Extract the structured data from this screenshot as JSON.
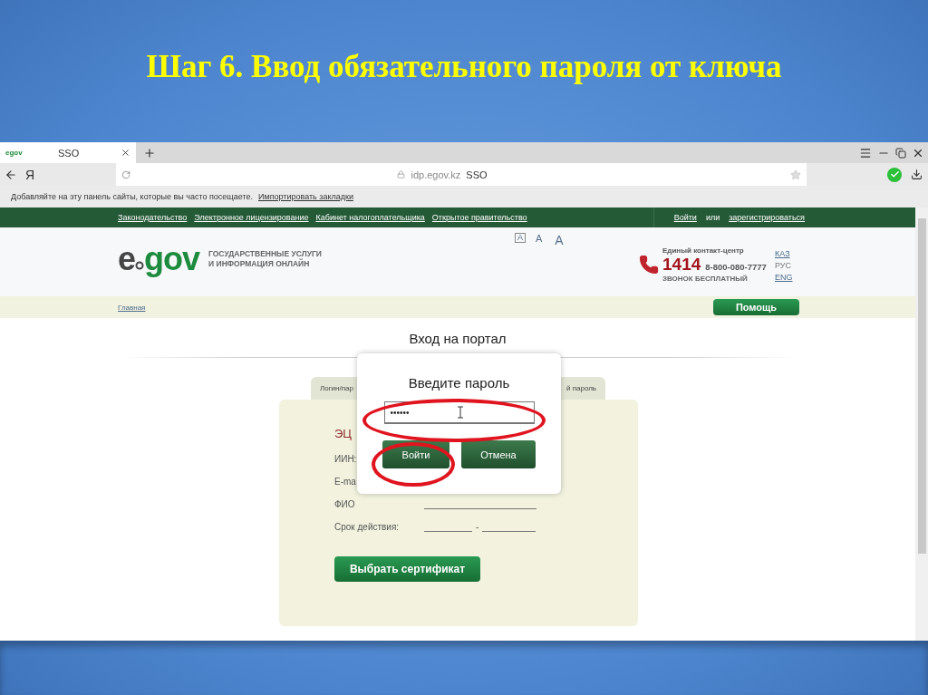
{
  "slide": {
    "title": "Шаг 6. Ввод обязательного пароля от ключа"
  },
  "browser": {
    "tabs": [
      {
        "favicon_text": "egov",
        "label": "SSO",
        "selected": true
      }
    ],
    "browser_logo": "Я",
    "address": {
      "domain": "idp.egov.kz",
      "page_title": "SSO"
    },
    "bookmarks_bar": {
      "message": "Добавляйте на эту панель сайты, которые вы часто посещаете.",
      "link": "Импортировать закладки"
    }
  },
  "site": {
    "nav_links": [
      "Законодательство",
      "Электронное лицензирование",
      "Кабинет налогоплательщика",
      "Открытое правительство"
    ],
    "auth": {
      "login": "Войти",
      "or": "или",
      "register": "зарегистрироваться"
    },
    "logo": [
      "e",
      "gov"
    ],
    "tagline": [
      "ГОСУДАРСТВЕННЫЕ УСЛУГИ",
      "И ИНФОРМАЦИЯ ОНЛАЙН"
    ],
    "font_sizes": [
      {
        "label": "A",
        "selected": true
      },
      {
        "label": "A",
        "selected": false
      },
      {
        "label": "A",
        "selected": false
      }
    ],
    "contact": {
      "title": "Единый контакт-центр",
      "short_number": "1414",
      "number": "8-800-080-7777",
      "note": "ЗВОНОК БЕСПЛАТНЫЙ"
    },
    "languages": [
      {
        "label": "КАЗ",
        "selected": false
      },
      {
        "label": "РУС",
        "selected": true
      },
      {
        "label": "ENG",
        "selected": false
      }
    ],
    "breadcrumb": "Главная",
    "help_button": "Помощь"
  },
  "login": {
    "heading": "Вход на портал",
    "tabs": [
      "Логин/пар",
      "й пароль"
    ],
    "section_title": "ЭЦ",
    "fields": [
      {
        "label": "ИИН:",
        "kind": "covered"
      },
      {
        "label": "E-ma",
        "kind": "covered"
      },
      {
        "label": "ФИО",
        "kind": "blank"
      },
      {
        "label": "Срок действия:",
        "kind": "range",
        "separator": "-"
      }
    ],
    "select_button": "Выбрать сертификат"
  },
  "dialog": {
    "title": "Введите пароль",
    "password": "••••••",
    "field_highlighted": true,
    "buttons": [
      {
        "label": "Войти",
        "highlighted": true
      },
      {
        "label": "Отмена",
        "highlighted": false
      }
    ]
  }
}
